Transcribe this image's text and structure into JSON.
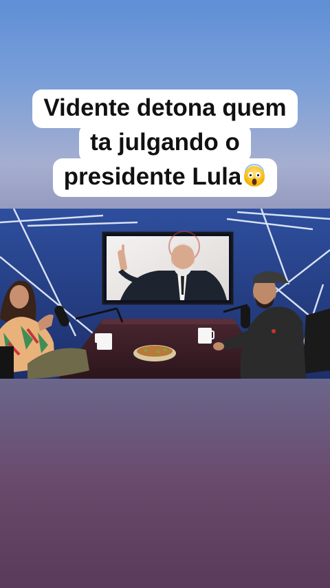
{
  "caption": {
    "line1": "Vidente detona quem",
    "line2": "ta julgando o",
    "line3": "presidente Lula",
    "emoji": "face-screaming-in-fear"
  },
  "video": {
    "scene": "podcast-studio-frame"
  }
}
